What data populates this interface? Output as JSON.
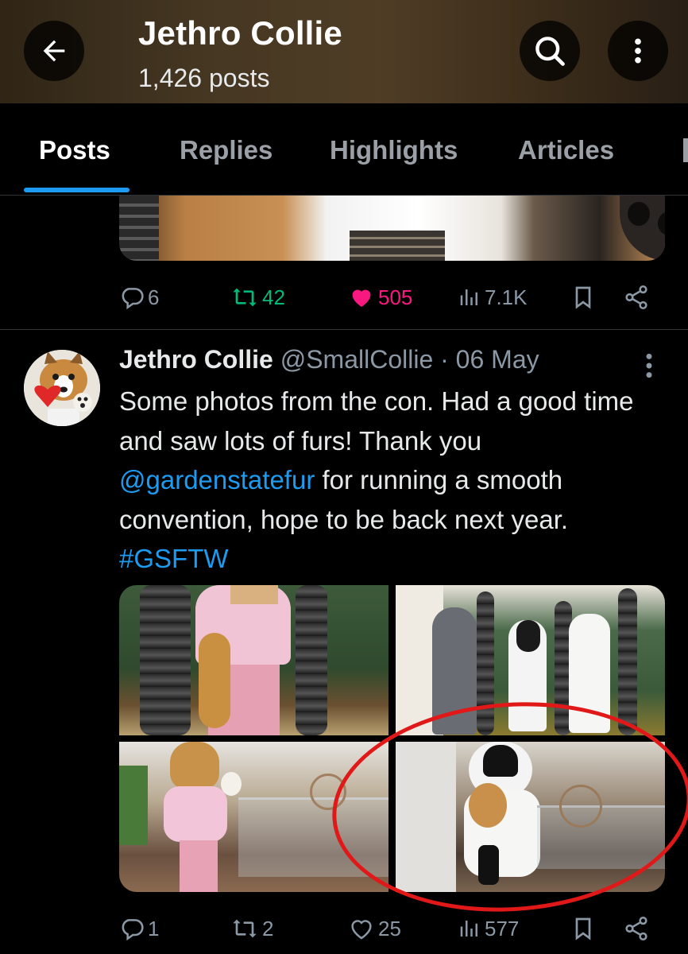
{
  "header": {
    "title": "Jethro Collie",
    "subtitle": "1,426 posts"
  },
  "tabs": [
    {
      "label": "Posts",
      "active": true
    },
    {
      "label": "Replies",
      "active": false
    },
    {
      "label": "Highlights",
      "active": false
    },
    {
      "label": "Articles",
      "active": false
    }
  ],
  "prev_post": {
    "replies": "6",
    "reposts": "42",
    "likes": "505",
    "views": "7.1K",
    "liked": true,
    "reposted": true
  },
  "post": {
    "author_name": "Jethro Collie",
    "author_handle": "@SmallCollie",
    "separator": " · ",
    "date": "06 May",
    "text_1": "Some photos from the con. Had a good time and saw lots of furs! Thank you ",
    "mention": "@gardenstatefur",
    "text_2": " for running a smooth convention, hope to be back next year.",
    "hashtag": "#GSFTW",
    "replies": "1",
    "reposts": "2",
    "likes": "25",
    "views": "577"
  },
  "colors": {
    "accent": "#1d9bf0",
    "like": "#f91880",
    "repost": "#00ba7c",
    "muted": "#8b98a5",
    "annotation": "#e01818"
  },
  "icons": [
    "back-arrow-icon",
    "search-icon",
    "more-vertical-icon",
    "reply-icon",
    "repost-icon",
    "heart-icon",
    "views-icon",
    "bookmark-icon",
    "share-icon"
  ]
}
